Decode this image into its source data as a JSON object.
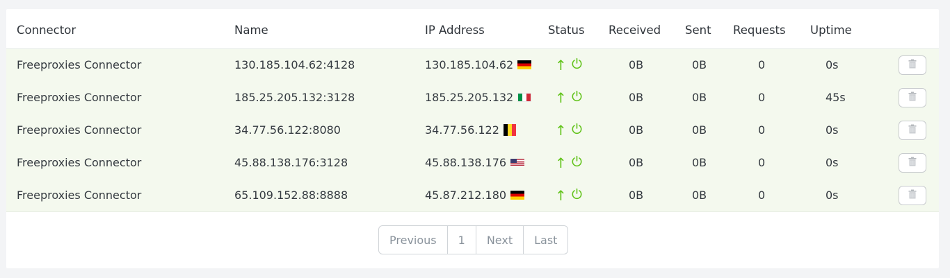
{
  "table": {
    "headers": {
      "connector": "Connector",
      "name": "Name",
      "ip": "IP Address",
      "status": "Status",
      "received": "Received",
      "sent": "Sent",
      "requests": "Requests",
      "uptime": "Uptime"
    },
    "rows": [
      {
        "connector": "Freeproxies Connector",
        "name": "130.185.104.62:4128",
        "ip": "130.185.104.62",
        "flag": "de",
        "received": "0B",
        "sent": "0B",
        "requests": "0",
        "uptime": "0s"
      },
      {
        "connector": "Freeproxies Connector",
        "name": "185.25.205.132:3128",
        "ip": "185.25.205.132",
        "flag": "it",
        "received": "0B",
        "sent": "0B",
        "requests": "0",
        "uptime": "45s"
      },
      {
        "connector": "Freeproxies Connector",
        "name": "34.77.56.122:8080",
        "ip": "34.77.56.122",
        "flag": "be",
        "received": "0B",
        "sent": "0B",
        "requests": "0",
        "uptime": "0s"
      },
      {
        "connector": "Freeproxies Connector",
        "name": "45.88.138.176:3128",
        "ip": "45.88.138.176",
        "flag": "us",
        "received": "0B",
        "sent": "0B",
        "requests": "0",
        "uptime": "0s"
      },
      {
        "connector": "Freeproxies Connector",
        "name": "65.109.152.88:8888",
        "ip": "45.87.212.180",
        "flag": "de",
        "received": "0B",
        "sent": "0B",
        "requests": "0",
        "uptime": "0s"
      }
    ],
    "status_icons": [
      "arrow-up-icon",
      "power-icon"
    ],
    "status_color": "#62c31b",
    "row_icon": "trash-icon"
  },
  "pagination": {
    "previous": "Previous",
    "page": "1",
    "next": "Next",
    "last": "Last"
  },
  "colors": {
    "row_background": "#f4f9ee",
    "page_background": "#f3f4f6"
  }
}
